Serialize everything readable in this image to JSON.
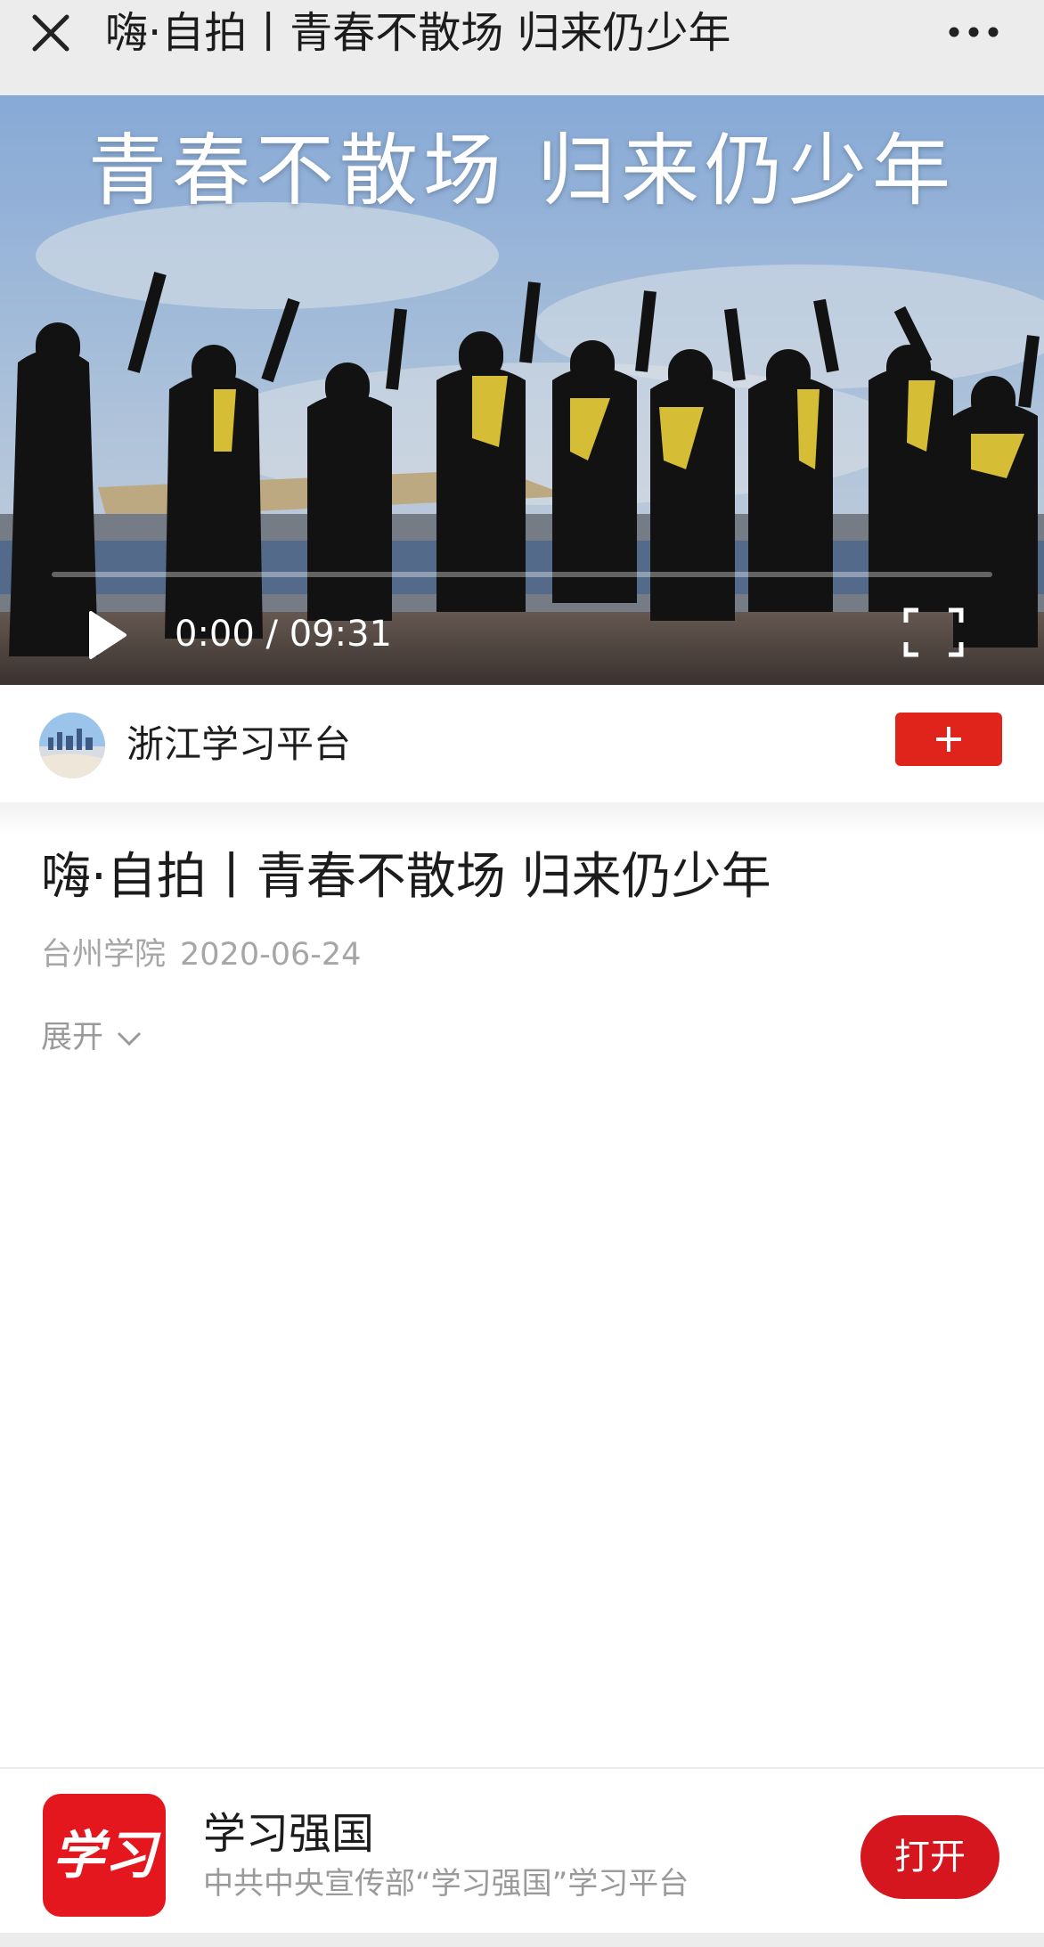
{
  "header": {
    "title": "嗨·自拍丨青春不散场 归来仍少年",
    "close_icon": "close-icon",
    "more_icon": "more-icon"
  },
  "video": {
    "overlay_title": "青春不散场 归来仍少年",
    "current_time": "0:00",
    "duration": "09:31",
    "time_text": "0:00 / 09:31",
    "progress": 0.0,
    "play_icon": "play-icon",
    "fullscreen_icon": "fullscreen-icon"
  },
  "account": {
    "name": "浙江学习平台",
    "follow_icon": "plus-icon",
    "follow_color": "#e0241b"
  },
  "article": {
    "title": "嗨·自拍丨青春不散场 归来仍少年",
    "source": "台州学院",
    "date": "2020-06-24",
    "expand_label": "展开"
  },
  "app_banner": {
    "logo_text": "学习",
    "name": "学习强国",
    "description": "中共中央宣传部“学习强国”学习平台",
    "open_label": "打开",
    "accent_color": "#d5161f"
  }
}
